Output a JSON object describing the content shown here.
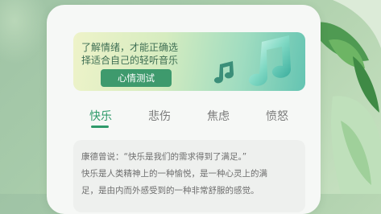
{
  "banner": {
    "line1": "了解情绪，才能正确选",
    "line2": "择适合自己的轻听音乐",
    "button_label": "心情测试",
    "icon": "music-note-icon"
  },
  "tabs": [
    {
      "label": "快乐",
      "active": true
    },
    {
      "label": "悲伤",
      "active": false
    },
    {
      "label": "焦虑",
      "active": false
    },
    {
      "label": "愤怒",
      "active": false
    }
  ],
  "quote": {
    "line1": "康德曾说：“快乐是我们的需求得到了满足。”",
    "line2": "快乐是人类精神上的一种愉悦，是一种心灵上的满",
    "line3": "足，是由内而外感受到的一种非常舒服的感觉。"
  },
  "colors": {
    "accent": "#2f9a6a",
    "button": "#3e9a6d",
    "background": "#a7cbaa"
  }
}
